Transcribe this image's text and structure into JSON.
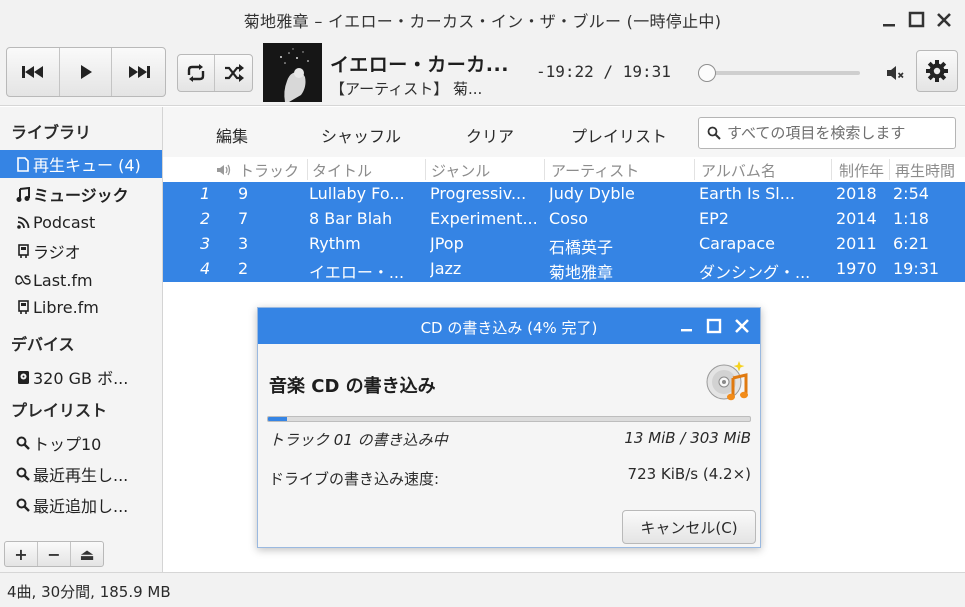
{
  "window": {
    "title": "菊地雅章 – イエロー・カーカス・イン・ザ・ブルー (一時停止中)"
  },
  "now_playing": {
    "title": "イエロー・カーカ...",
    "artist": "【アーティスト】 菊...",
    "time": "-19:22 / 19:31",
    "seek_progress": 0.0
  },
  "sidebar": {
    "library_heading": "ライブラリ",
    "items": [
      {
        "label": "再生キュー (4)",
        "icon": "document-icon"
      },
      {
        "label": "ミュージック",
        "icon": "music-note-icon"
      },
      {
        "label": "Podcast",
        "icon": "rss-icon"
      },
      {
        "label": "ラジオ",
        "icon": "radio-icon"
      },
      {
        "label": "Last.fm",
        "icon": "lastfm-icon"
      },
      {
        "label": "Libre.fm",
        "icon": "librefm-icon"
      }
    ],
    "devices_heading": "デバイス",
    "devices": [
      {
        "label": "320 GB ボ...",
        "icon": "harddisk-icon"
      }
    ],
    "playlists_heading": "プレイリスト",
    "playlists": [
      {
        "label": "トップ10",
        "icon": "search-icon"
      },
      {
        "label": "最近再生し...",
        "icon": "search-icon"
      },
      {
        "label": "最近追加し...",
        "icon": "search-icon"
      }
    ],
    "tools": [
      "+",
      "−",
      "⏏"
    ]
  },
  "content_bar": {
    "edit": "編集",
    "shuffle": "シャッフル",
    "clear": "クリア",
    "playlist": "プレイリスト",
    "search_placeholder": "すべての項目を検索します"
  },
  "table": {
    "headers": [
      "トラック",
      "タイトル",
      "ジャンル",
      "アーティスト",
      "アルバム名",
      "制作年",
      "再生時間"
    ],
    "rows": [
      {
        "index": "1",
        "track": "9",
        "title": "Lullaby Fo...",
        "genre": "Progressiv...",
        "artist": "Judy Dyble",
        "album": "Earth Is Sl...",
        "year": "2018",
        "length": "2:54"
      },
      {
        "index": "2",
        "track": "7",
        "title": "8 Bar Blah",
        "genre": "Experiment...",
        "artist": "Coso",
        "album": "EP2",
        "year": "2014",
        "length": "1:18"
      },
      {
        "index": "3",
        "track": "3",
        "title": "Rythm",
        "genre": "JPop",
        "artist": "石橋英子",
        "album": "Carapace",
        "year": "2011",
        "length": "6:21"
      },
      {
        "index": "4",
        "track": "2",
        "title": "イエロー・...",
        "genre": "Jazz",
        "artist": "菊地雅章",
        "album": "ダンシング・...",
        "year": "1970",
        "length": "19:31"
      }
    ]
  },
  "status": {
    "summary": "4曲, 30分間, 185.9 MB"
  },
  "dialog": {
    "title": "CD の書き込み (4% 完了)",
    "heading": "音楽 CD の書き込み",
    "progress": 0.04,
    "status": "トラック 01 の書き込み中",
    "size": "13 MiB / 303 MiB",
    "speed_label": "ドライブの書き込み速度:",
    "speed_value": "723 KiB/s (4.2×)",
    "cancel": "キャンセル(C)"
  },
  "colors": {
    "accent": "#3584e4",
    "selection_text": "#ffffff",
    "background": "#f2f2f2"
  }
}
